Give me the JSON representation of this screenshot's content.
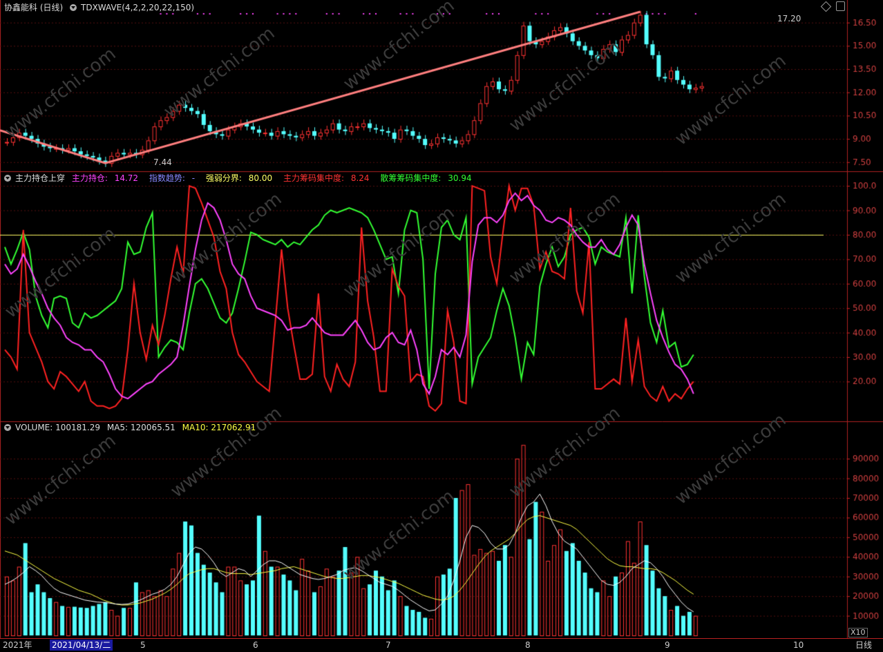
{
  "panel1": {
    "stock_title": "协鑫能科 (日线)",
    "indicator": "TDXWAVE(4,2,2,20,22,150)",
    "high_label": "17.20",
    "low_label": "7.44",
    "y_ticks": [
      "16.50",
      "15.00",
      "13.50",
      "12.00",
      "10.50",
      "9.00",
      "7.50"
    ]
  },
  "panel2": {
    "name": "主力持仓上穿",
    "items": [
      {
        "label": "主力持仓: ",
        "value": "14.72",
        "color": "#ff44ff"
      },
      {
        "label": "指数趋势: ",
        "value": "-",
        "color": "#8888ff"
      },
      {
        "label": "强弱分界: ",
        "value": "80.00",
        "color": "#ffff66"
      },
      {
        "label": "主力筹码集中度: ",
        "value": "8.24",
        "color": "#ff3333"
      },
      {
        "label": "散筹筹码集中度: ",
        "value": "30.94",
        "color": "#33ff33"
      }
    ],
    "y_ticks": [
      "100.0",
      "90.00",
      "80.00",
      "70.00",
      "60.00",
      "50.00",
      "40.00",
      "30.00",
      "20.00"
    ]
  },
  "panel3": {
    "name": "VOLUME: ",
    "volume": "100181.29",
    "ma5_label": "MA5: ",
    "ma5": "120065.51",
    "ma10_label": "MA10: ",
    "ma10": "217062.91",
    "y_ticks": [
      "90000",
      "80000",
      "70000",
      "60000",
      "50000",
      "40000",
      "30000",
      "20000",
      "10000"
    ],
    "unit": "X10"
  },
  "bottom": {
    "year": "2021年",
    "cursor_date": "2021/04/13/二",
    "months": [
      "5",
      "6",
      "7",
      "8",
      "9",
      "10"
    ],
    "period": "日线"
  },
  "watermark": "www.cfchi.com",
  "colors": {
    "up": "#ff3333",
    "down": "#54ffff",
    "border": "#b22222",
    "wave": "#ff7f7f"
  },
  "chart_data": {
    "type": "candlestick",
    "close": [
      8.8,
      9.1,
      9.4,
      9.2,
      9.0,
      8.7,
      8.5,
      8.4,
      8.4,
      8.3,
      8.4,
      8.2,
      8.0,
      7.9,
      7.8,
      7.6,
      7.44,
      7.9,
      8.1,
      8.0,
      8.1,
      8.0,
      8.3,
      8.9,
      9.8,
      10.2,
      10.4,
      10.8,
      11.2,
      11.0,
      10.8,
      10.6,
      9.9,
      9.5,
      9.3,
      9.2,
      9.6,
      9.8,
      10.0,
      9.8,
      9.6,
      9.4,
      9.4,
      9.2,
      9.5,
      9.3,
      9.2,
      9.1,
      9.3,
      9.5,
      9.2,
      9.4,
      9.6,
      10.0,
      9.6,
      9.5,
      9.8,
      9.8,
      10.0,
      9.7,
      9.6,
      9.5,
      9.4,
      9.0,
      9.6,
      9.5,
      9.2,
      9.0,
      8.6,
      8.7,
      9.1,
      9.0,
      8.9,
      8.7,
      8.9,
      9.3,
      10.2,
      11.3,
      12.4,
      12.7,
      12.2,
      12.1,
      12.8,
      14.4,
      16.3,
      15.3,
      15.1,
      15.3,
      15.6,
      16.0,
      16.2,
      15.8,
      15.3,
      15.0,
      14.7,
      14.4,
      14.2,
      14.8,
      15.1,
      14.6,
      15.4,
      15.7,
      16.5,
      17.0,
      15.1,
      14.4,
      13.0,
      12.9,
      13.4,
      12.8,
      12.5,
      12.2,
      12.3,
      12.4
    ],
    "volume": [
      30000,
      28000,
      35000,
      47000,
      22000,
      26000,
      22000,
      19000,
      17000,
      15000,
      14500,
      14600,
      14200,
      14000,
      15000,
      16000,
      17000,
      13000,
      10000,
      14000,
      14000,
      27000,
      22000,
      23000,
      20000,
      23000,
      20000,
      34000,
      42000,
      58000,
      56000,
      42000,
      36000,
      32000,
      27000,
      22000,
      35000,
      35000,
      28000,
      26000,
      28000,
      61000,
      43000,
      35000,
      35000,
      31000,
      28000,
      23000,
      39000,
      33000,
      22000,
      25000,
      34000,
      30000,
      33000,
      45000,
      32000,
      40000,
      24000,
      26000,
      33000,
      30000,
      23000,
      28000,
      20000,
      15000,
      13000,
      12000,
      9000,
      8500,
      30000,
      31000,
      34000,
      70000,
      74000,
      77000,
      41000,
      44000,
      42000,
      43000,
      38000,
      46000,
      40000,
      90000,
      97000,
      49000,
      68000,
      63000,
      38000,
      46000,
      54000,
      43000,
      47000,
      38000,
      32000,
      24000,
      22000,
      28000,
      20000,
      30000,
      32000,
      48000,
      37000,
      58000,
      46000,
      33000,
      24000,
      20000,
      13000,
      15000,
      10000,
      12000,
      10000
    ],
    "ma5": [
      26000,
      27500,
      29500,
      32000,
      35000,
      33000,
      30500,
      27000,
      24000,
      22000,
      21000,
      20000,
      19000,
      18000,
      17500,
      17000,
      16800,
      16500,
      16000,
      15800,
      16000,
      17000,
      18000,
      19500,
      21000,
      22000,
      23500,
      26000,
      30000,
      36000,
      42000,
      45000,
      44000,
      41000,
      37000,
      32000,
      30000,
      32000,
      34000,
      33000,
      30000,
      33000,
      36000,
      38000,
      38000,
      37000,
      35000,
      33000,
      31000,
      30000,
      29000,
      28500,
      29000,
      30000,
      31000,
      33000,
      34000,
      34500,
      33000,
      31000,
      29000,
      27000,
      26000,
      25000,
      23000,
      20500,
      18000,
      16000,
      14000,
      12500,
      13000,
      16000,
      20000,
      28000,
      38000,
      50000,
      56000,
      55000,
      52000,
      47000,
      44000,
      44000,
      46000,
      52000,
      60000,
      66000,
      68000,
      72000,
      66000,
      58000,
      52000,
      48000,
      46000,
      44000,
      40000,
      36000,
      32000,
      28000,
      26000,
      25500,
      27000,
      30000,
      34000,
      36000,
      38000,
      37000,
      34000,
      30000,
      25000,
      21000,
      17000,
      14000,
      12000
    ],
    "ma10": [
      43000,
      42000,
      41000,
      39000,
      37000,
      35000,
      33000,
      31000,
      29000,
      27500,
      26000,
      24500,
      23000,
      22000,
      21000,
      19500,
      18000,
      17000,
      16000,
      15500,
      15500,
      16000,
      16500,
      17500,
      18500,
      20000,
      21500,
      23500,
      26000,
      29000,
      31500,
      32500,
      33500,
      34000,
      34000,
      33000,
      32000,
      31500,
      31500,
      31500,
      31000,
      31500,
      32000,
      32500,
      33000,
      34000,
      34500,
      35000,
      34000,
      33000,
      32000,
      31000,
      30000,
      29500,
      29000,
      29000,
      29500,
      30000,
      30500,
      30500,
      30000,
      29500,
      28500,
      27500,
      26500,
      25000,
      23500,
      22000,
      20500,
      19500,
      18500,
      18000,
      18500,
      20000,
      23000,
      27000,
      31500,
      36000,
      40000,
      43000,
      45000,
      47000,
      49000,
      52000,
      56000,
      59000,
      60500,
      61000,
      60000,
      59000,
      58000,
      57000,
      56000,
      54000,
      51000,
      48000,
      45000,
      42000,
      39000,
      37000,
      35500,
      35000,
      35000,
      34500,
      34000,
      34000,
      33500,
      32000,
      30000,
      28000,
      25500,
      23000,
      21000
    ],
    "zhuli_chicang": [
      68,
      64,
      66,
      72,
      67,
      61,
      56,
      50,
      46,
      43,
      38,
      36,
      35,
      33,
      33,
      30,
      28,
      23,
      17,
      14,
      13,
      15,
      17,
      19,
      20,
      23,
      25,
      27,
      30,
      43,
      59,
      74,
      86,
      93,
      91,
      86,
      78,
      68,
      64,
      62,
      55,
      50,
      49,
      48,
      47,
      45,
      41,
      42,
      42,
      43,
      46,
      43,
      40,
      39,
      39,
      39,
      42,
      45,
      41,
      36,
      33,
      34,
      38,
      40,
      36,
      35,
      41,
      33,
      19,
      15,
      22,
      33,
      31,
      34,
      30,
      39,
      69,
      84,
      87,
      87,
      85,
      88,
      94,
      97,
      94,
      96,
      92,
      90,
      86,
      85,
      87,
      86,
      84,
      80,
      77,
      75,
      75,
      78,
      74,
      72,
      76,
      83,
      88,
      84,
      68,
      56,
      45,
      38,
      32,
      27,
      25,
      21,
      15
    ],
    "zhuli_jizhong": [
      33,
      30,
      25,
      82,
      40,
      34,
      28,
      20,
      17,
      24,
      22,
      19,
      16,
      20,
      12,
      10,
      10,
      9,
      10,
      13,
      33,
      60,
      40,
      29,
      43,
      35,
      47,
      62,
      75,
      64,
      100,
      99,
      93,
      86,
      79,
      65,
      58,
      40,
      31,
      28,
      24,
      20,
      18,
      16,
      45,
      74,
      50,
      35,
      21,
      21,
      23,
      56,
      22,
      16,
      27,
      21,
      18,
      28,
      83,
      53,
      38,
      16,
      16,
      66,
      59,
      55,
      20,
      23,
      22,
      10,
      8,
      11,
      49,
      36,
      12,
      11,
      100,
      99,
      98,
      71,
      60,
      81,
      100,
      90,
      99,
      99,
      92,
      66,
      73,
      65,
      64,
      62,
      91,
      57,
      48,
      77,
      17,
      17,
      19,
      21,
      19,
      46,
      20,
      37,
      18,
      14,
      12,
      18,
      12,
      15,
      13,
      17,
      20
    ],
    "sanchou_jizhong": [
      75,
      68,
      74,
      81,
      74,
      55,
      47,
      42,
      54,
      55,
      54,
      44,
      42,
      48,
      46,
      47,
      49,
      51,
      53,
      58,
      77,
      72,
      73,
      83,
      89,
      30,
      34,
      37,
      36,
      33,
      48,
      60,
      62,
      58,
      52,
      46,
      44,
      48,
      58,
      69,
      81,
      80,
      78,
      77,
      76,
      78,
      75,
      77,
      76,
      79,
      82,
      84,
      88,
      90,
      89,
      90,
      91,
      90,
      89,
      87,
      82,
      76,
      70,
      71,
      56,
      82,
      90,
      89,
      70,
      17,
      64,
      83,
      86,
      80,
      78,
      87,
      19,
      30,
      34,
      38,
      49,
      58,
      51,
      38,
      21,
      36,
      31,
      59,
      68,
      75,
      67,
      71,
      80,
      82,
      83,
      79,
      68,
      75,
      73,
      72,
      71,
      87,
      56,
      88,
      63,
      44,
      36,
      49,
      34,
      36,
      26,
      27,
      31
    ]
  }
}
